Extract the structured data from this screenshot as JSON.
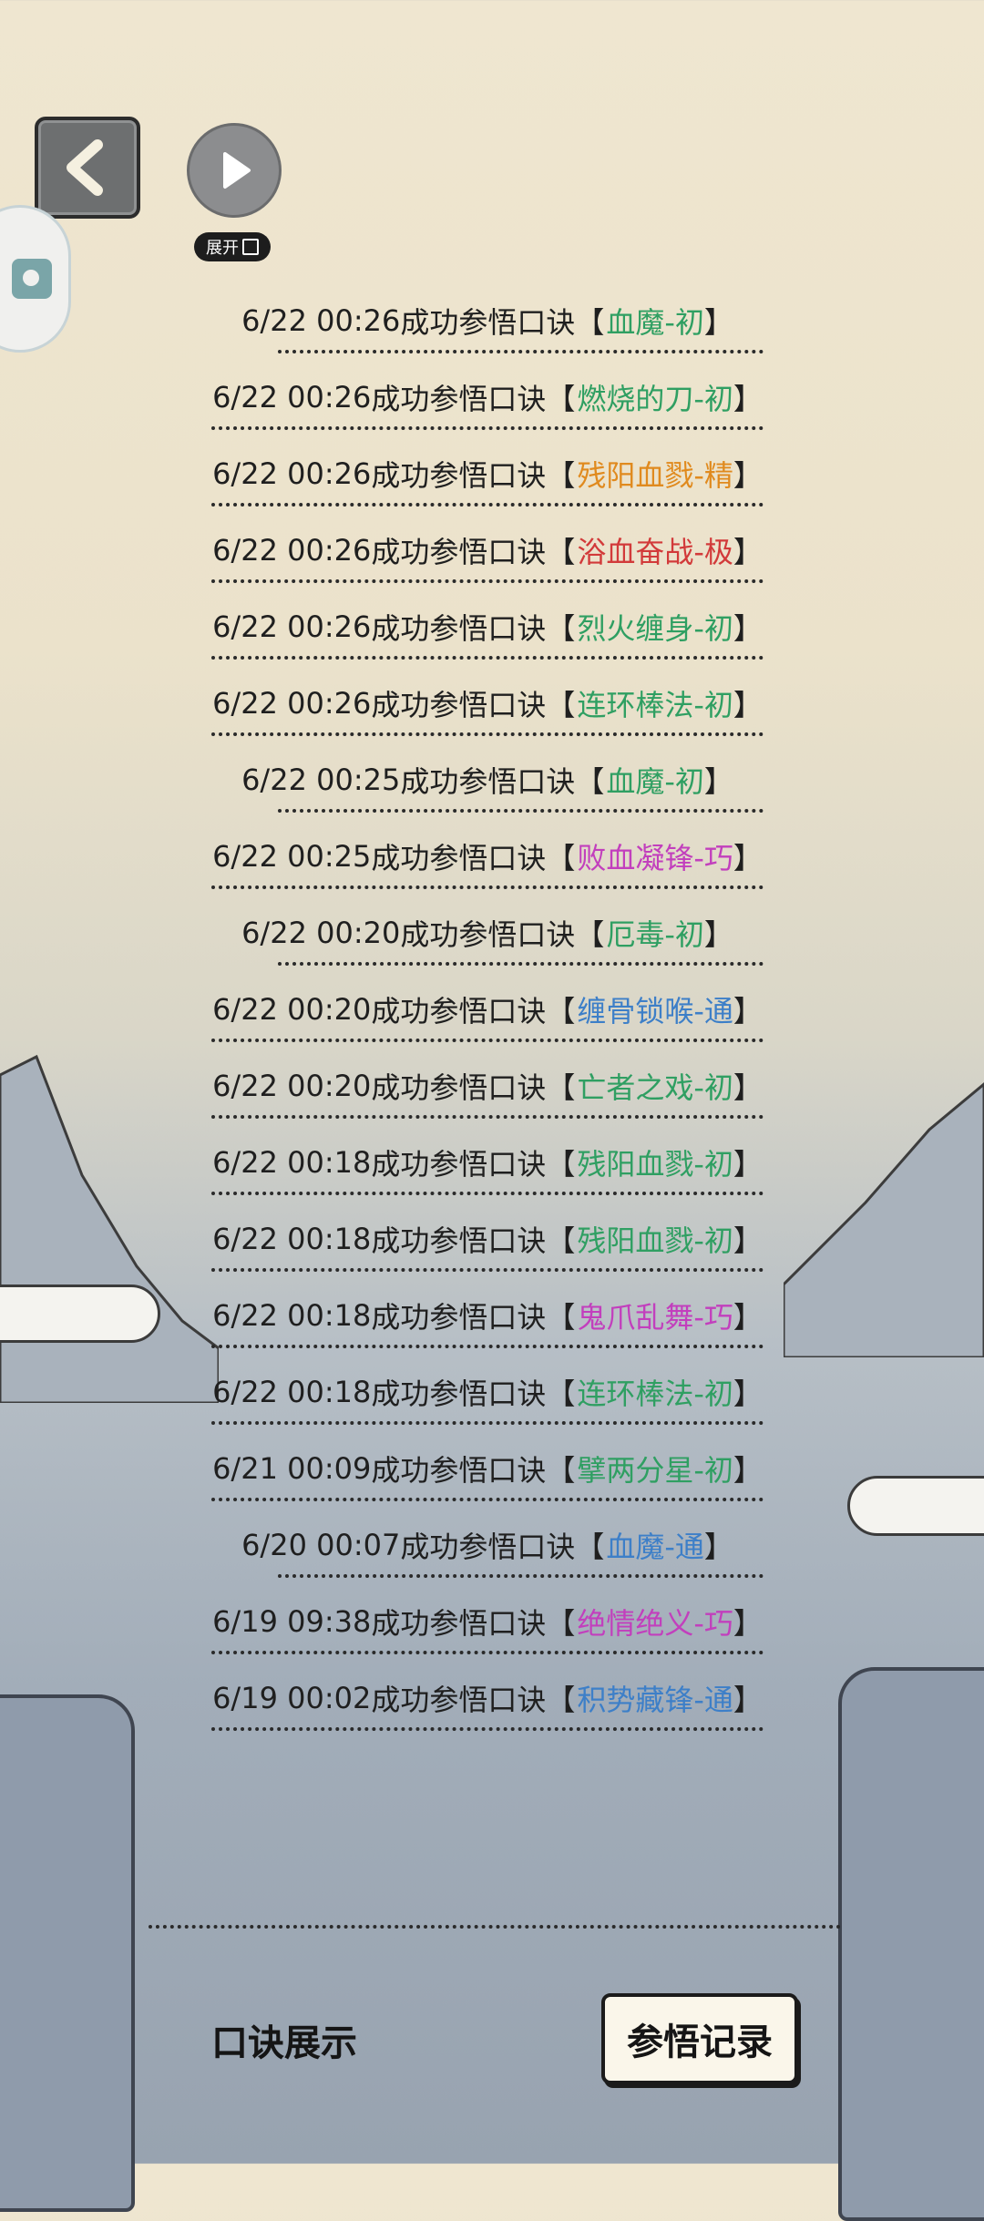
{
  "header": {
    "expand_label": "展开"
  },
  "records": [
    {
      "time": "6/22 00:26",
      "action": "成功参悟口诀",
      "skill": "血魔-初",
      "color": "green",
      "width": "short"
    },
    {
      "time": "6/22 00:26",
      "action": "成功参悟口诀",
      "skill": "燃烧的刀-初",
      "color": "green",
      "width": "full"
    },
    {
      "time": "6/22 00:26",
      "action": "成功参悟口诀",
      "skill": "残阳血戮-精",
      "color": "orange",
      "width": "full"
    },
    {
      "time": "6/22 00:26",
      "action": "成功参悟口诀",
      "skill": "浴血奋战-极",
      "color": "red",
      "width": "full"
    },
    {
      "time": "6/22 00:26",
      "action": "成功参悟口诀",
      "skill": "烈火缠身-初",
      "color": "green",
      "width": "full"
    },
    {
      "time": "6/22 00:26",
      "action": "成功参悟口诀",
      "skill": "连环棒法-初",
      "color": "green",
      "width": "full"
    },
    {
      "time": "6/22 00:25",
      "action": "成功参悟口诀",
      "skill": "血魔-初",
      "color": "green",
      "width": "short"
    },
    {
      "time": "6/22 00:25",
      "action": "成功参悟口诀",
      "skill": "败血凝锋-巧",
      "color": "purple",
      "width": "full"
    },
    {
      "time": "6/22 00:20",
      "action": "成功参悟口诀",
      "skill": "厄毒-初",
      "color": "green",
      "width": "short"
    },
    {
      "time": "6/22 00:20",
      "action": "成功参悟口诀",
      "skill": "缠骨锁喉-通",
      "color": "blue",
      "width": "full"
    },
    {
      "time": "6/22 00:20",
      "action": "成功参悟口诀",
      "skill": "亡者之戏-初",
      "color": "green",
      "width": "full"
    },
    {
      "time": "6/22 00:18",
      "action": "成功参悟口诀",
      "skill": "残阳血戮-初",
      "color": "green",
      "width": "full"
    },
    {
      "time": "6/22 00:18",
      "action": "成功参悟口诀",
      "skill": "残阳血戮-初",
      "color": "green",
      "width": "full"
    },
    {
      "time": "6/22 00:18",
      "action": "成功参悟口诀",
      "skill": "鬼爪乱舞-巧",
      "color": "purple",
      "width": "full"
    },
    {
      "time": "6/22 00:18",
      "action": "成功参悟口诀",
      "skill": "连环棒法-初",
      "color": "green",
      "width": "full"
    },
    {
      "time": "6/21 00:09",
      "action": "成功参悟口诀",
      "skill": "擘两分星-初",
      "color": "green",
      "width": "full"
    },
    {
      "time": "6/20 00:07",
      "action": "成功参悟口诀",
      "skill": "血魔-通",
      "color": "blue",
      "width": "short"
    },
    {
      "time": "6/19 09:38",
      "action": "成功参悟口诀",
      "skill": "绝情绝义-巧",
      "color": "purple",
      "width": "full"
    },
    {
      "time": "6/19 00:02",
      "action": "成功参悟口诀",
      "skill": "积势藏锋-通",
      "color": "blue",
      "width": "full"
    }
  ],
  "bottom_tabs": {
    "show_label": "口诀展示",
    "records_label": "参悟记录"
  }
}
